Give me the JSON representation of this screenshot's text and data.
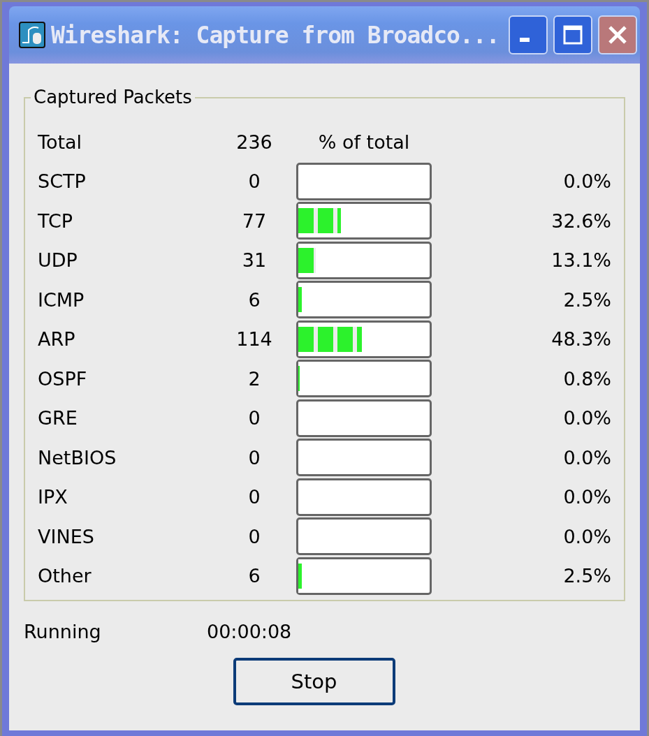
{
  "window": {
    "title": "Wireshark: Capture from Broadco..."
  },
  "group": {
    "title": "Captured Packets",
    "total_label": "Total",
    "total_count": "236",
    "bar_header": "% of total",
    "rows": [
      {
        "name": "SCTP",
        "count": "0",
        "percent": "0.0%"
      },
      {
        "name": "TCP",
        "count": "77",
        "level": 0.326,
        "percent": "32.6%"
      },
      {
        "name": "UDP",
        "count": "31",
        "level": 0.131,
        "percent": "13.1%"
      },
      {
        "name": "ICMP",
        "count": "6",
        "level": 0.025,
        "percent": "2.5%"
      },
      {
        "name": "ARP",
        "count": "114",
        "level": 0.483,
        "percent": "48.3%"
      },
      {
        "name": "OSPF",
        "count": "2",
        "level": 0.008,
        "percent": "0.8%"
      },
      {
        "name": "GRE",
        "count": "0",
        "percent": "0.0%"
      },
      {
        "name": "NetBIOS",
        "count": "0",
        "percent": "0.0%"
      },
      {
        "name": "IPX",
        "count": "0",
        "percent": "0.0%"
      },
      {
        "name": "VINES",
        "count": "0",
        "percent": "0.0%"
      },
      {
        "name": "Other",
        "count": "6",
        "level": 0.025,
        "percent": "2.5%"
      }
    ]
  },
  "status": {
    "label": "Running",
    "time": "00:00:08"
  },
  "button": "Stop"
}
